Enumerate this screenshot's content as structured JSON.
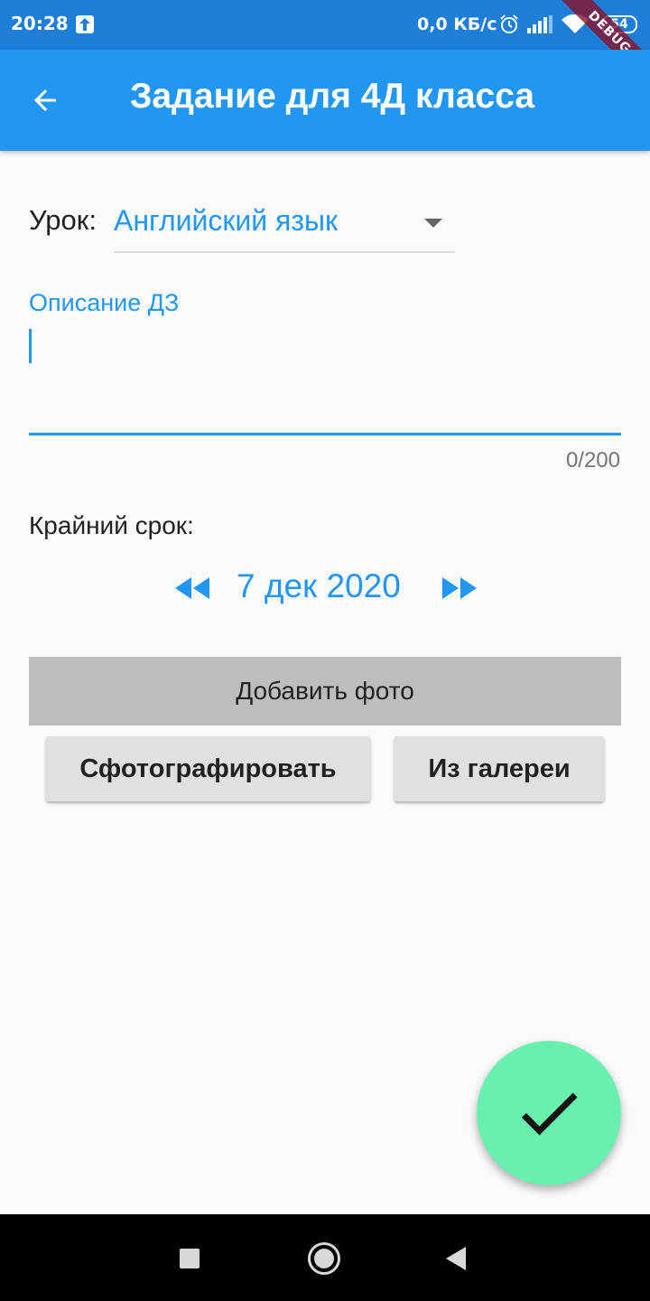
{
  "status_bar": {
    "time": "20:28",
    "net_speed": "0,0 КБ/с",
    "battery": "54",
    "icons": [
      "upload-icon",
      "alarm-icon",
      "signal-icon",
      "wifi-icon",
      "battery-icon"
    ]
  },
  "debug_banner": "DEBUG",
  "app_bar": {
    "title": "Задание для 4Д класса",
    "back_icon": "arrow-back-icon",
    "background": "#2196f3"
  },
  "form": {
    "lesson_label": "Урок:",
    "lesson_value": "Английский язык",
    "description_label": "Описание ДЗ",
    "description_value": "",
    "description_counter": "0/200",
    "deadline_label": "Крайний срок:",
    "deadline_date": "7 дек 2020",
    "prev_icon": "fast-rewind-icon",
    "next_icon": "fast-forward-icon"
  },
  "photo": {
    "add_photo_label": "Добавить фото",
    "camera_button": "Сфотографировать",
    "gallery_button": "Из галереи"
  },
  "fab": {
    "icon": "check-icon",
    "color": "#69f0ae"
  },
  "nav_bar": {
    "icons": [
      "recent-apps-icon",
      "home-icon",
      "back-icon"
    ]
  }
}
